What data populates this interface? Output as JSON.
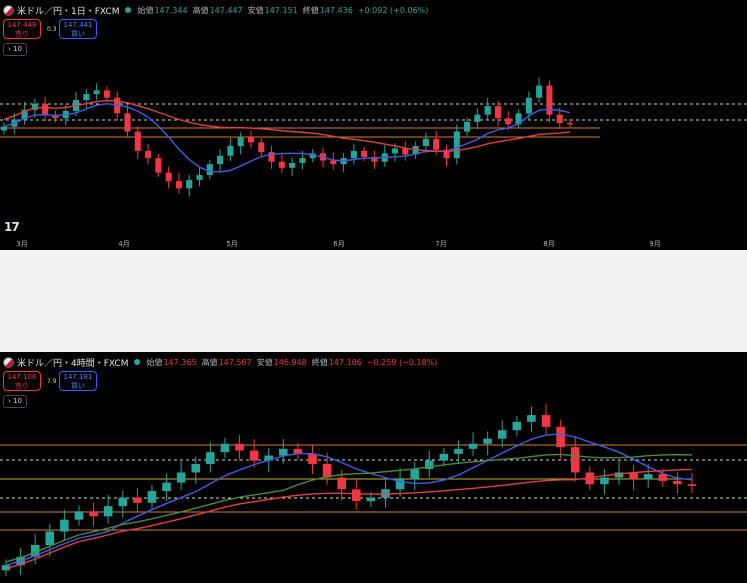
{
  "charts": [
    {
      "header": {
        "symbol": "米ドル／円・1日・FXCM",
        "open_label": "始値",
        "open": "147.344",
        "high_label": "高値",
        "high": "147.447",
        "low_label": "安値",
        "low": "147.151",
        "close_label": "終値",
        "close": "147.436",
        "change": "+0.092 (+0.06%)",
        "change_color": "#26a69a"
      },
      "sell_price": "147.449",
      "sell_label": "売り",
      "buy_price": "147.441",
      "buy_label": "買い",
      "spread": "0.3",
      "volume": "10",
      "logo": "17"
    },
    {
      "header": {
        "symbol": "米ドル／円・4時間・FXCM",
        "open_label": "始値",
        "open": "147.365",
        "high_label": "高値",
        "high": "147.567",
        "low_label": "安値",
        "low": "146.948",
        "close_label": "終値",
        "close": "147.106",
        "change": "−0.259 (−0.18%)",
        "change_color": "#f23645"
      },
      "sell_price": "147.106",
      "sell_label": "売り",
      "buy_price": "147.181",
      "buy_label": "買い",
      "spread": "7.9",
      "volume": "10"
    }
  ],
  "chart_data": [
    {
      "type": "candlestick",
      "title": "米ドル／円・1日・FXCM",
      "x_tick_labels": [
        "3月",
        "4月",
        "5月",
        "6月",
        "7月",
        "8月",
        "9月"
      ],
      "series": [
        {
          "name": "price",
          "color_up": "#26a69a",
          "color_down": "#f23645",
          "values": [
            147.2,
            147.8,
            148.6,
            149.1,
            148.2,
            147.9,
            148.5,
            149.4,
            149.9,
            150.2,
            149.6,
            148.3,
            146.8,
            145.2,
            144.6,
            143.4,
            142.7,
            142.1,
            142.8,
            143.2,
            144.1,
            144.8,
            145.6,
            146.3,
            145.9,
            145.1,
            144.3,
            143.8,
            144.2,
            144.6,
            145.0,
            144.4,
            144.1,
            144.6,
            145.2,
            144.7,
            144.3,
            145.0,
            145.4,
            144.9,
            145.6,
            146.2,
            145.3,
            144.6,
            146.8,
            147.6,
            148.2,
            148.9,
            147.9,
            147.4,
            148.3,
            149.6,
            150.6,
            148.2,
            147.5,
            147.4
          ]
        }
      ],
      "overlays": [
        {
          "name": "fast ma",
          "color": "#3f5fe0"
        },
        {
          "name": "slow ma",
          "color": "#e04048"
        }
      ],
      "levels": [
        {
          "color": "#d0d0d0",
          "style": "dashed"
        },
        {
          "color": "#d0d0d0",
          "style": "dashed"
        },
        {
          "color": "#d0802a",
          "style": "solid"
        },
        {
          "color": "#d0802a",
          "style": "solid"
        }
      ]
    },
    {
      "type": "candlestick",
      "title": "米ドル／円・4時間・FXCM",
      "series": [
        {
          "name": "price",
          "color_up": "#26a69a",
          "color_down": "#f23645",
          "values": [
            142.4,
            142.9,
            143.6,
            144.4,
            145.1,
            145.6,
            145.3,
            145.9,
            146.4,
            146.1,
            146.8,
            147.3,
            147.9,
            148.4,
            149.1,
            149.6,
            149.2,
            148.6,
            148.9,
            149.3,
            149.0,
            148.4,
            147.6,
            146.9,
            146.2,
            146.4,
            146.9,
            147.5,
            148.1,
            148.6,
            149.0,
            149.3,
            149.6,
            149.9,
            150.4,
            150.9,
            151.3,
            150.6,
            149.4,
            147.9,
            147.2,
            147.6,
            147.9,
            147.5,
            147.8,
            147.4,
            147.2,
            147.1
          ]
        }
      ],
      "overlays": [
        {
          "name": "fast ma",
          "color": "#3f5fe0"
        },
        {
          "name": "mid ma",
          "color": "#4a8a3a"
        },
        {
          "name": "slow ma",
          "color": "#e04048"
        }
      ],
      "levels": [
        {
          "color": "#d0802a",
          "style": "solid"
        },
        {
          "color": "#d0d0d0",
          "style": "dashed"
        },
        {
          "color": "#c8b030",
          "style": "solid"
        },
        {
          "color": "#e0e0a0",
          "style": "dashed"
        },
        {
          "color": "#d0802a",
          "style": "solid"
        },
        {
          "color": "#d0802a",
          "style": "solid"
        }
      ]
    }
  ]
}
